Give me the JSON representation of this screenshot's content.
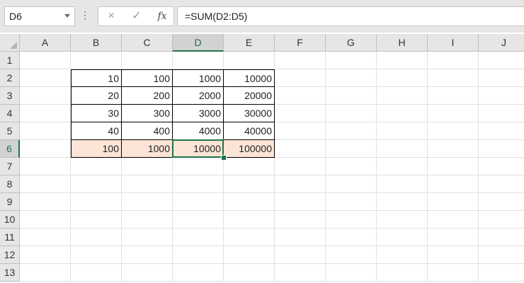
{
  "name_box": {
    "value": "D6"
  },
  "formula_bar": {
    "cancel_icon": "×",
    "enter_icon": "✓",
    "fx_label": "fx",
    "formula": "=SUM(D2:D5)"
  },
  "columns": [
    "A",
    "B",
    "C",
    "D",
    "E",
    "F",
    "G",
    "H",
    "I",
    "J"
  ],
  "rows": [
    "1",
    "2",
    "3",
    "4",
    "5",
    "6",
    "7",
    "8",
    "9",
    "10",
    "11",
    "12",
    "13"
  ],
  "selected": {
    "column": "D",
    "row": "6"
  },
  "table": {
    "rows": [
      [
        "10",
        "100",
        "1000",
        "10000"
      ],
      [
        "20",
        "200",
        "2000",
        "20000"
      ],
      [
        "30",
        "300",
        "3000",
        "30000"
      ],
      [
        "40",
        "400",
        "4000",
        "40000"
      ],
      [
        "100",
        "1000",
        "10000",
        "100000"
      ]
    ]
  },
  "colors": {
    "accent": "#217346",
    "total_fill": "#fce4d6"
  }
}
